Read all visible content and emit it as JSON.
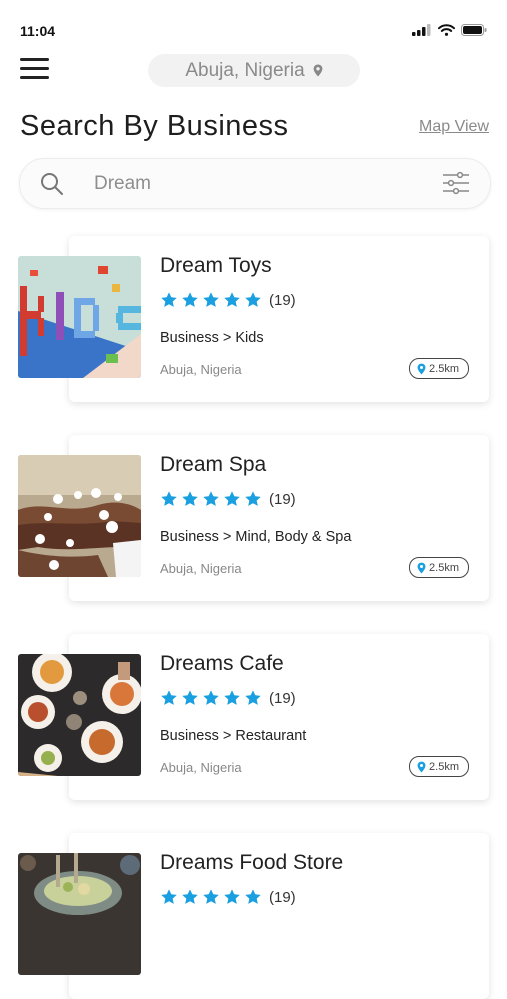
{
  "status_bar": {
    "time": "11:04"
  },
  "header": {
    "location": "Abuja, Nigeria"
  },
  "page": {
    "title": "Search By Business",
    "map_view_label": "Map View"
  },
  "search": {
    "value": "Dream"
  },
  "colors": {
    "star": "#1a9fe0",
    "pin": "#1a9fe0"
  },
  "results": [
    {
      "name": "Dream Toys",
      "rating_count": "(19)",
      "category": "Business > Kids",
      "location": "Abuja, Nigeria",
      "distance": "2.5km",
      "stars": 5
    },
    {
      "name": "Dream Spa",
      "rating_count": "(19)",
      "category": "Business > Mind, Body & Spa",
      "location": "Abuja, Nigeria",
      "distance": "2.5km",
      "stars": 5
    },
    {
      "name": "Dreams Cafe",
      "rating_count": "(19)",
      "category": "Business > Restaurant",
      "location": "Abuja, Nigeria",
      "distance": "2.5km",
      "stars": 5
    },
    {
      "name": "Dreams Food Store",
      "rating_count": "(19)",
      "category": "",
      "location": "",
      "distance": "",
      "stars": 5
    }
  ]
}
